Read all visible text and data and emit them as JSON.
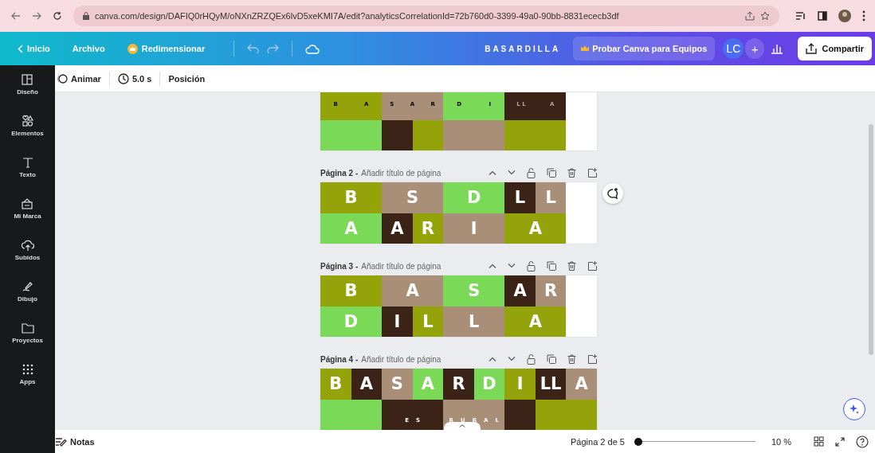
{
  "browser": {
    "url": "canva.com/design/DAFIQ0rHQyM/oNXnZRZQEx6lvD5xeKMI7A/edit?analyticsCorrelationId=72b760d0-3399-49a0-90bb-8831ececb3df"
  },
  "header": {
    "home": "Inicio",
    "file": "Archivo",
    "resize": "Redimensionar",
    "title": "BASARDILLA",
    "teams": "Probar Canva para Equipos",
    "avatar": "LC",
    "plus": "+",
    "share": "Compartir"
  },
  "sidebar": [
    {
      "label": "Diseño",
      "kind": "layout"
    },
    {
      "label": "Elementos",
      "kind": "shapes"
    },
    {
      "label": "Texto",
      "kind": "text"
    },
    {
      "label": "Mi Marca",
      "kind": "brand"
    },
    {
      "label": "Subidos",
      "kind": "upload"
    },
    {
      "label": "Dibujo",
      "kind": "draw"
    },
    {
      "label": "Proyectos",
      "kind": "folder"
    },
    {
      "label": "Apps",
      "kind": "apps"
    }
  ],
  "toolbar": {
    "animate": "Animar",
    "duration": "5.0 s",
    "position": "Posición"
  },
  "pages": [
    {
      "selected": false,
      "tiles": [
        {
          "kind": "wide",
          "color": "#95a30a",
          "letters": [
            "B",
            "A"
          ]
        },
        {
          "kind": "wide",
          "color": "#a98e78",
          "letters": [
            "S",
            "A",
            "R"
          ]
        },
        {
          "kind": "wide",
          "color": "#7ad957",
          "letters": [
            "D",
            "I"
          ]
        },
        {
          "kind": "wide",
          "color": "#3c2318",
          "letters": [
            "L L",
            "A"
          ]
        },
        {
          "kind": "narrow",
          "color": "#ffffff"
        },
        {
          "kind": "wide",
          "color": "#7ad957"
        },
        {
          "kind": "narrow",
          "color": "#3c2318"
        },
        {
          "kind": "narrow",
          "color": "#95a30a"
        },
        {
          "kind": "wide",
          "color": "#a98e78"
        },
        {
          "kind": "wide",
          "color": "#95a30a"
        },
        {
          "kind": "narrow",
          "color": "#ffffff"
        }
      ]
    },
    {
      "number": "Página 2 -",
      "title": "Añadir título de página",
      "selected": true,
      "tiles": [
        {
          "kind": "wide",
          "color": "#95a30a",
          "letters": [
            "B"
          ]
        },
        {
          "kind": "wide",
          "color": "#a98e78",
          "letters": [
            "S"
          ]
        },
        {
          "kind": "wide",
          "color": "#7ad957",
          "letters": [
            "D"
          ]
        },
        {
          "kind": "narrow",
          "color": "#3c2318",
          "letters": [
            "L"
          ]
        },
        {
          "kind": "narrow",
          "color": "#a98e78",
          "letters": [
            "L"
          ]
        },
        {
          "kind": "narrow",
          "color": "#ffffff"
        },
        {
          "kind": "wide",
          "color": "#7ad957",
          "letters": [
            "A"
          ]
        },
        {
          "kind": "narrow",
          "color": "#3c2318",
          "letters": [
            "A"
          ]
        },
        {
          "kind": "narrow",
          "color": "#95a30a",
          "letters": [
            "R"
          ]
        },
        {
          "kind": "wide",
          "color": "#a98e78",
          "letters": [
            "I"
          ]
        },
        {
          "kind": "wide",
          "color": "#95a30a",
          "letters": [
            "A"
          ]
        },
        {
          "kind": "narrow",
          "color": "#ffffff"
        }
      ]
    },
    {
      "number": "Página 3 -",
      "title": "Añadir título de página",
      "selected": false,
      "tiles": [
        {
          "kind": "wide",
          "color": "#95a30a",
          "letters": [
            "B"
          ]
        },
        {
          "kind": "wide",
          "color": "#a98e78",
          "letters": [
            "A"
          ]
        },
        {
          "kind": "wide",
          "color": "#7ad957",
          "letters": [
            "S"
          ]
        },
        {
          "kind": "narrow",
          "color": "#3c2318",
          "letters": [
            "A"
          ]
        },
        {
          "kind": "narrow",
          "color": "#a98e78",
          "letters": [
            "R"
          ]
        },
        {
          "kind": "narrow",
          "color": "#ffffff"
        },
        {
          "kind": "wide",
          "color": "#7ad957",
          "letters": [
            "D"
          ]
        },
        {
          "kind": "narrow",
          "color": "#3c2318",
          "letters": [
            "I"
          ]
        },
        {
          "kind": "narrow",
          "color": "#95a30a",
          "letters": [
            "L"
          ]
        },
        {
          "kind": "wide",
          "color": "#a98e78",
          "letters": [
            "L"
          ]
        },
        {
          "kind": "wide",
          "color": "#95a30a",
          "letters": [
            "A"
          ]
        },
        {
          "kind": "narrow",
          "color": "#ffffff"
        }
      ]
    },
    {
      "number": "Página 4 -",
      "title": "Añadir título de página",
      "selected": false,
      "tiles": [
        {
          "kind": "narrow",
          "color": "#95a30a",
          "letters": [
            "B"
          ]
        },
        {
          "kind": "narrow",
          "color": "#3c2318",
          "letters": [
            "A"
          ]
        },
        {
          "kind": "narrow",
          "color": "#a98e78",
          "letters": [
            "S"
          ]
        },
        {
          "kind": "narrow",
          "color": "#7ad957",
          "letters": [
            "A"
          ]
        },
        {
          "kind": "narrow",
          "color": "#3c2318",
          "letters": [
            "R"
          ]
        },
        {
          "kind": "narrow",
          "color": "#7ad957",
          "letters": [
            "D"
          ]
        },
        {
          "kind": "narrow",
          "color": "#95a30a",
          "letters": [
            "I"
          ]
        },
        {
          "kind": "narrow",
          "color": "#3c2318",
          "letters": [
            "LL"
          ]
        },
        {
          "kind": "narrow",
          "color": "#a98e78",
          "letters": [
            "A"
          ]
        },
        {
          "kind": "wide",
          "color": "#7ad957"
        },
        {
          "kind": "wide",
          "color": "#3c2318",
          "letters": [
            "E",
            "S"
          ]
        },
        {
          "kind": "wide",
          "color": "#a98e78",
          "letters": [
            "R",
            "U",
            "R",
            "A",
            "L"
          ]
        },
        {
          "kind": "narrow",
          "color": "#3c2318"
        },
        {
          "kind": "wide",
          "color": "#95a30a"
        }
      ]
    }
  ],
  "footer": {
    "notes": "Notas",
    "page": "Página 2 de 5",
    "level": 0.02,
    "zoom": "10 %"
  }
}
